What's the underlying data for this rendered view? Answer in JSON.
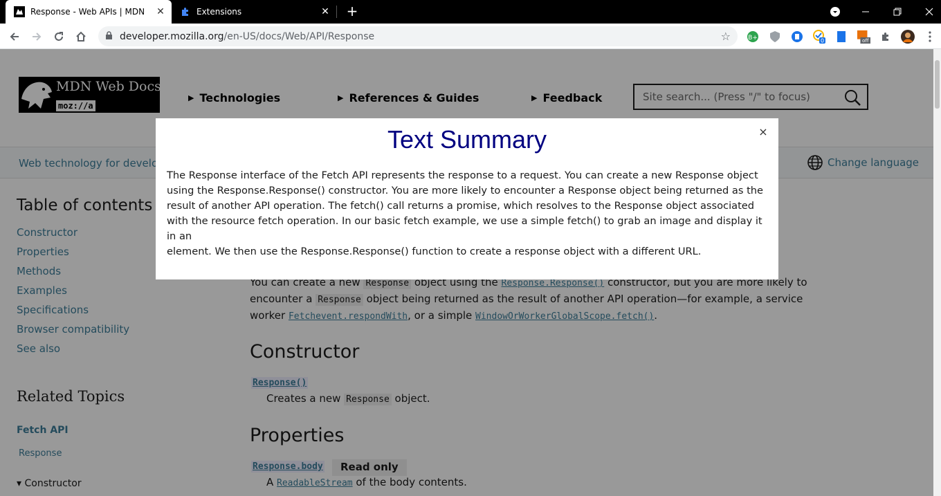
{
  "browser": {
    "tabs": [
      {
        "title": "Response - Web APIs | MDN",
        "active": true,
        "favicon": "mdn-icon"
      },
      {
        "title": "Extensions",
        "active": false,
        "favicon": "puzzle-icon"
      }
    ],
    "url_domain": "developer.mozilla.org",
    "url_path": "/en-US/docs/Web/API/Response",
    "extension_badges": {
      "todo": "0",
      "pdf": "off"
    }
  },
  "header": {
    "logo_name": "MDN Web Docs",
    "logo_sub": "moz://a",
    "nav": [
      "Technologies",
      "References & Guides",
      "Feedback"
    ],
    "search_placeholder": "Site search... (Press \"/\" to focus)"
  },
  "strip": {
    "tagline": "Web technology for develo",
    "change_language": "Change language"
  },
  "sidebar": {
    "toc_title": "Table of contents",
    "toc_items": [
      "Constructor",
      "Properties",
      "Methods",
      "Examples",
      "Specifications",
      "Browser compatibility",
      "See also"
    ],
    "related_title": "Related Topics",
    "related_api": "Fetch API",
    "related_response": "Response",
    "related_constructor": "▾ Constructor"
  },
  "content": {
    "intro": {
      "t1": "You can create a new ",
      "c1": "Response",
      "t2": " object using the ",
      "l1": "Response.Response()",
      "t3": " constructor, but you are more likely to encounter a ",
      "c2": "Response",
      "t4": " object being returned as the result of another API operation—for example, a service worker ",
      "l2": "Fetchevent.respondWith",
      "t5": ", or a simple ",
      "l3": "WindowOrWorkerGlobalScope.fetch()",
      "t6": "."
    },
    "constructor_heading": "Constructor",
    "constructor_term": "Response()",
    "constructor_desc_1": "Creates a new ",
    "constructor_desc_code": "Response",
    "constructor_desc_2": " object.",
    "properties_heading": "Properties",
    "property_term": "Response.body",
    "property_badge": "Read only",
    "property_desc_1": "A ",
    "property_desc_link": "ReadableStream",
    "property_desc_2": " of the body contents."
  },
  "modal": {
    "title": "Text Summary",
    "close": "×",
    "body": "The Response interface of the Fetch API represents the response to a request. You can create a new Response object using the Response.Response() constructor. You are more likely to encounter a Response object being returned as the result of another API operation. The fetch() call returns a promise, which resolves to the Response object associated with the resource fetch operation. In our basic fetch example, we use a simple fetch() to grab an image and display it in an\nelement. We then use the Response.Response() function to create a response object with a different URL."
  }
}
